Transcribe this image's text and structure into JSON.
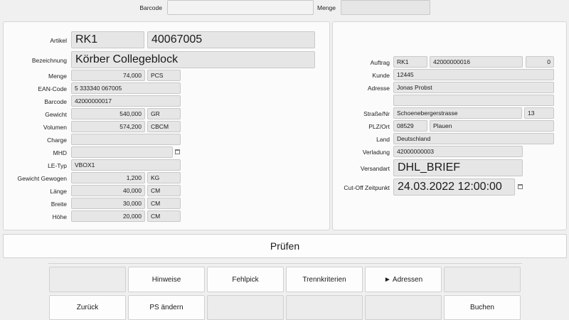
{
  "top": {
    "barcode_label": "Barcode",
    "barcode_value": "",
    "menge_label": "Menge",
    "menge_value": ""
  },
  "article": {
    "artikel_label": "Artikel",
    "artikel_code": "RK1",
    "artikel_nr": "40067005",
    "bezeichnung_label": "Bezeichnung",
    "bezeichnung": "Körber Collegeblock",
    "menge_label": "Menge",
    "menge_value": "74,000",
    "menge_unit": "PCS",
    "ean_label": "EAN-Code",
    "ean_value": "5 333340 067005",
    "barcode_label": "Barcode",
    "barcode_value": "42000000017",
    "gewicht_label": "Gewicht",
    "gewicht_value": "540,000",
    "gewicht_unit": "GR",
    "volumen_label": "Volumen",
    "volumen_value": "574,200",
    "volumen_unit": "CBCM",
    "charge_label": "Charge",
    "charge_value": "",
    "mhd_label": "MHD",
    "mhd_value": "",
    "letyp_label": "LE-Typ",
    "letyp_value": "VBOX1",
    "gewogen_label": "Gewicht Gewogen",
    "gewogen_value": "1,200",
    "gewogen_unit": "KG",
    "laenge_label": "Länge",
    "laenge_value": "40,000",
    "laenge_unit": "CM",
    "breite_label": "Breite",
    "breite_value": "30,000",
    "breite_unit": "CM",
    "hoehe_label": "Höhe",
    "hoehe_value": "20,000",
    "hoehe_unit": "CM"
  },
  "order": {
    "auftrag_label": "Auftrag",
    "auftrag_code": "RK1",
    "auftrag_nr": "42000000016",
    "auftrag_count": "0",
    "kunde_label": "Kunde",
    "kunde_value": "12445",
    "adresse_label": "Adresse",
    "adresse_value": "Jonas Probst",
    "adresse2_value": "",
    "strasse_label": "Straße/Nr",
    "strasse_value": "Schoenebergerstrasse",
    "hausnr_value": "13",
    "plz_label": "PLZ/Ort",
    "plz_value": "08529",
    "ort_value": "Plauen",
    "land_label": "Land",
    "land_value": "Deutschland",
    "verladung_label": "Verladung",
    "verladung_value": "42000000003",
    "versandart_label": "Versandart",
    "versandart_value": "DHL_BRIEF",
    "cutoff_label": "Cut-Off Zeitpunkt",
    "cutoff_value": "24.03.2022 12:00:00"
  },
  "pruefen_label": "Prüfen",
  "buttons": {
    "hinweise": "Hinweise",
    "fehlpick": "Fehlpick",
    "trennkriterien": "Trennkriterien",
    "adressen": "► Adressen",
    "zurueck": "Zurück",
    "ps_aendern": "PS ändern",
    "buchen": "Buchen"
  },
  "icons": {
    "calendar": "calendar-icon"
  }
}
